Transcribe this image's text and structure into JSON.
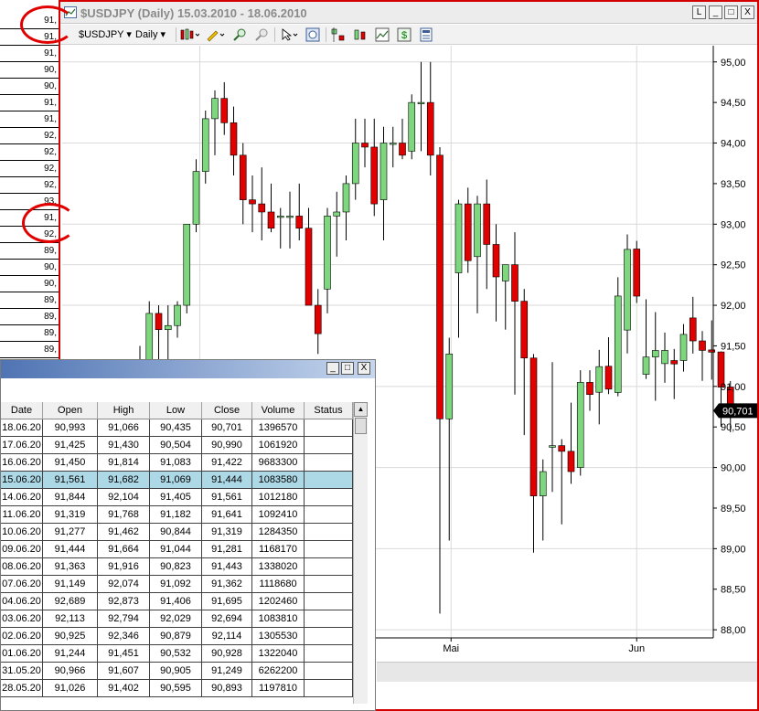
{
  "background_list": {
    "values": [
      "91,",
      "91,",
      "91,",
      "90,",
      "90,",
      "91,",
      "91,",
      "92,",
      "92,",
      "92,",
      "92,",
      "93,",
      "91,",
      "92,",
      "89,",
      "90,",
      "90,",
      "89,",
      "89,",
      "89,",
      "89,",
      "88,",
      "89,",
      "90,",
      "92,"
    ]
  },
  "chart_window": {
    "title": "$USDJPY (Daily) 15.03.2010 - 18.06.2010",
    "symbol_dropdown": "$USDJPY",
    "period_dropdown": "Daily",
    "win_buttons": {
      "restore": "L",
      "minimize": "_",
      "maximize": "□",
      "close": "X"
    },
    "toolbar_icons": [
      "candles-icon",
      "pencil-icon",
      "zoom-in-icon",
      "zoom-out-icon",
      "cursor-icon",
      "magnifier-icon",
      "buy-sell-icon",
      "bars-icon",
      "line-chart-icon",
      "dollar-icon",
      "template-icon"
    ],
    "last_price_label": "90,701"
  },
  "chart_data": {
    "type": "candlestick",
    "title": "",
    "x_tick_labels": [
      {
        "label": "Mai",
        "index": 33
      },
      {
        "label": "Jun",
        "index": 53
      }
    ],
    "ylim": [
      87.9,
      95.2
    ],
    "y_ticks": [
      "95,00",
      "94,50",
      "94,00",
      "93,50",
      "93,00",
      "92,50",
      "92,00",
      "91,50",
      "91,00",
      "90,50",
      "90,00",
      "89,50",
      "89,00",
      "88,50",
      "88,00"
    ],
    "y_tick_values": [
      95.0,
      94.5,
      94.0,
      93.5,
      93.0,
      92.5,
      92.0,
      91.5,
      91.0,
      90.5,
      90.0,
      89.5,
      89.0,
      88.5,
      88.0
    ],
    "last_price": 90.701,
    "up_color": "#7ed67e",
    "down_color": "#e00000",
    "candles": [
      [
        90.3,
        91.5,
        89.9,
        91.3
      ],
      [
        91.3,
        92.05,
        90.85,
        91.9
      ],
      [
        91.9,
        92.0,
        91.3,
        91.7
      ],
      [
        91.7,
        92.0,
        91.3,
        91.75
      ],
      [
        91.75,
        92.05,
        91.6,
        92.0
      ],
      [
        92.0,
        93.0,
        91.9,
        93.0
      ],
      [
        93.0,
        93.8,
        92.9,
        93.65
      ],
      [
        93.65,
        94.4,
        93.5,
        94.3
      ],
      [
        94.3,
        94.65,
        93.85,
        94.55
      ],
      [
        94.55,
        94.75,
        94.1,
        94.25
      ],
      [
        94.25,
        94.45,
        93.6,
        93.85
      ],
      [
        93.85,
        94.0,
        93.0,
        93.3
      ],
      [
        93.3,
        93.6,
        92.9,
        93.25
      ],
      [
        93.25,
        93.7,
        92.8,
        93.15
      ],
      [
        93.15,
        93.5,
        92.9,
        92.95
      ],
      [
        93.1,
        93.2,
        92.7,
        93.1
      ],
      [
        93.1,
        93.4,
        92.7,
        93.1
      ],
      [
        93.1,
        93.5,
        92.8,
        92.95
      ],
      [
        92.95,
        93.2,
        92.2,
        92.0
      ],
      [
        92.0,
        92.2,
        91.4,
        91.65
      ],
      [
        92.2,
        93.2,
        91.9,
        93.1
      ],
      [
        93.1,
        93.4,
        92.6,
        93.15
      ],
      [
        93.15,
        93.6,
        92.8,
        93.5
      ],
      [
        93.5,
        94.3,
        93.3,
        94.0
      ],
      [
        94.0,
        94.3,
        93.7,
        93.95
      ],
      [
        93.95,
        94.3,
        93.1,
        93.25
      ],
      [
        93.3,
        94.2,
        92.8,
        94.0
      ],
      [
        94.0,
        94.2,
        93.7,
        94.0
      ],
      [
        94.0,
        94.3,
        93.8,
        93.85
      ],
      [
        93.9,
        94.6,
        93.8,
        94.5
      ],
      [
        94.5,
        95.0,
        93.9,
        94.5
      ],
      [
        94.5,
        95.0,
        93.6,
        93.85
      ],
      [
        93.85,
        93.95,
        88.2,
        90.6
      ],
      [
        90.6,
        91.6,
        89.1,
        91.4
      ],
      [
        92.4,
        93.3,
        91.6,
        93.25
      ],
      [
        93.25,
        93.45,
        92.4,
        92.55
      ],
      [
        92.6,
        93.35,
        91.9,
        93.25
      ],
      [
        93.25,
        93.55,
        92.2,
        92.75
      ],
      [
        92.75,
        93.0,
        91.8,
        92.35
      ],
      [
        92.3,
        92.5,
        91.7,
        92.5
      ],
      [
        92.5,
        92.9,
        90.9,
        92.05
      ],
      [
        92.05,
        92.2,
        90.4,
        91.35
      ],
      [
        91.35,
        91.4,
        88.95,
        89.65
      ],
      [
        89.65,
        90.1,
        89.1,
        89.95
      ],
      [
        90.25,
        91.3,
        89.7,
        90.27
      ],
      [
        90.27,
        90.35,
        89.3,
        90.2
      ],
      [
        90.2,
        90.8,
        89.8,
        89.95
      ],
      [
        90.0,
        91.2,
        89.9,
        91.05
      ],
      [
        91.05,
        91.2,
        90.7,
        90.9
      ],
      [
        90.928,
        91.451,
        90.532,
        91.244
      ],
      [
        91.249,
        91.607,
        90.905,
        90.966
      ],
      [
        90.925,
        92.346,
        90.879,
        92.114
      ],
      [
        91.695,
        92.873,
        91.406,
        92.689
      ],
      [
        92.694,
        92.794,
        92.029,
        92.113
      ],
      [
        91.149,
        92.074,
        91.092,
        91.362
      ],
      [
        91.363,
        91.916,
        90.823,
        91.443
      ],
      [
        91.281,
        91.664,
        91.044,
        91.444
      ],
      [
        91.319,
        91.462,
        90.844,
        91.277
      ],
      [
        91.319,
        91.768,
        91.182,
        91.641
      ],
      [
        91.844,
        92.104,
        91.405,
        91.561
      ],
      [
        91.561,
        91.682,
        91.069,
        91.444
      ],
      [
        91.45,
        91.814,
        91.083,
        91.422
      ],
      [
        91.425,
        91.43,
        90.504,
        90.99
      ],
      [
        90.993,
        91.066,
        90.435,
        90.701
      ]
    ]
  },
  "data_table": {
    "columns": [
      "Date",
      "Open",
      "High",
      "Low",
      "Close",
      "Volume",
      "Status"
    ],
    "selected_row": 3,
    "rows": [
      [
        "18.06.20",
        "90,993",
        "91,066",
        "90,435",
        "90,701",
        "1396570",
        ""
      ],
      [
        "17.06.20",
        "91,425",
        "91,430",
        "90,504",
        "90,990",
        "1061920",
        ""
      ],
      [
        "16.06.20",
        "91,450",
        "91,814",
        "91,083",
        "91,422",
        "9683300",
        ""
      ],
      [
        "15.06.20",
        "91,561",
        "91,682",
        "91,069",
        "91,444",
        "1083580",
        ""
      ],
      [
        "14.06.20",
        "91,844",
        "92,104",
        "91,405",
        "91,561",
        "1012180",
        ""
      ],
      [
        "11.06.20",
        "91,319",
        "91,768",
        "91,182",
        "91,641",
        "1092410",
        ""
      ],
      [
        "10.06.20",
        "91,277",
        "91,462",
        "90,844",
        "91,319",
        "1284350",
        ""
      ],
      [
        "09.06.20",
        "91,444",
        "91,664",
        "91,044",
        "91,281",
        "1168170",
        ""
      ],
      [
        "08.06.20",
        "91,363",
        "91,916",
        "90,823",
        "91,443",
        "1338020",
        ""
      ],
      [
        "07.06.20",
        "91,149",
        "92,074",
        "91,092",
        "91,362",
        "1118680",
        ""
      ],
      [
        "04.06.20",
        "92,689",
        "92,873",
        "91,406",
        "91,695",
        "1202460",
        ""
      ],
      [
        "03.06.20",
        "92,113",
        "92,794",
        "92,029",
        "92,694",
        "1083810",
        ""
      ],
      [
        "02.06.20",
        "90,925",
        "92,346",
        "90,879",
        "92,114",
        "1305530",
        ""
      ],
      [
        "01.06.20",
        "91,244",
        "91,451",
        "90,532",
        "90,928",
        "1322040",
        ""
      ],
      [
        "31.05.20",
        "90,966",
        "91,607",
        "90,905",
        "91,249",
        "6262200",
        ""
      ],
      [
        "28.05.20",
        "91,026",
        "91,402",
        "90,595",
        "90,893",
        "1197810",
        ""
      ]
    ]
  }
}
